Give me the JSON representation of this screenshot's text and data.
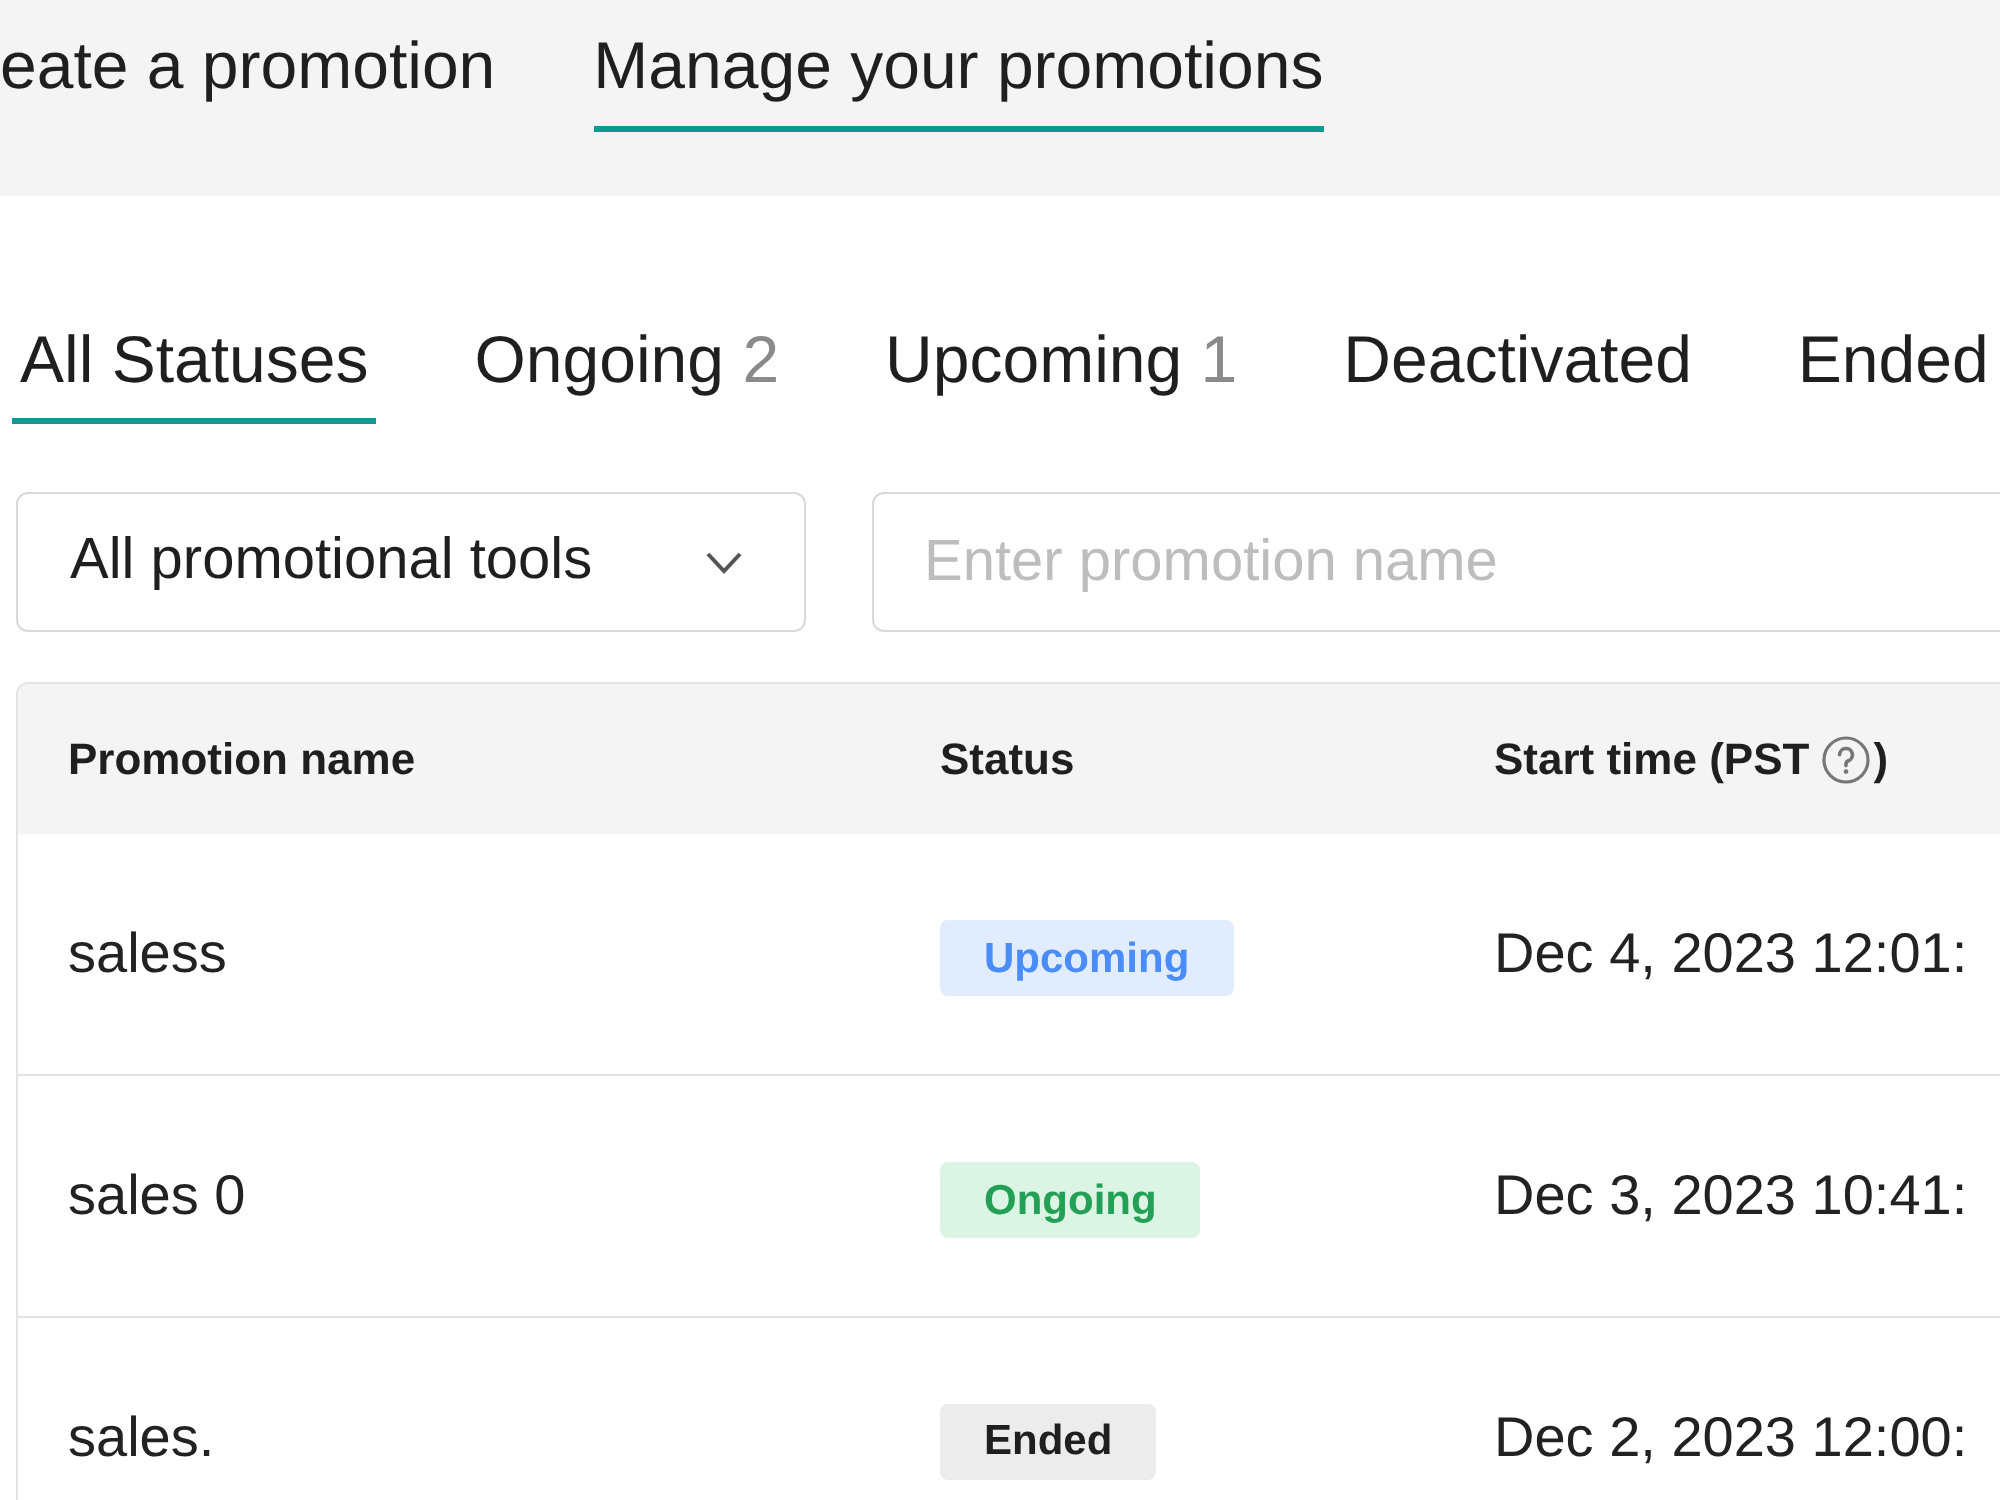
{
  "top_tabs": [
    {
      "label": "eate a promotion",
      "selected": false
    },
    {
      "label": "Manage your promotions",
      "selected": true
    }
  ],
  "status_tabs": [
    {
      "label": "All Statuses",
      "selected": true
    },
    {
      "label": "Ongoing",
      "count": "2",
      "selected": false
    },
    {
      "label": "Upcoming",
      "count": "1",
      "selected": false
    },
    {
      "label": "Deactivated",
      "selected": false
    },
    {
      "label": "Ended",
      "selected": false
    }
  ],
  "filters": {
    "tool_select": {
      "value": "All promotional tools"
    },
    "search": {
      "placeholder": "Enter promotion name"
    }
  },
  "table": {
    "columns": [
      {
        "label": "Promotion name"
      },
      {
        "label": "Status"
      },
      {
        "label": "Start time (PST",
        "help_icon": true,
        "label_end": ")"
      }
    ],
    "rows": [
      {
        "promotion_name": "saless",
        "status": {
          "label": "Upcoming",
          "kind": "upcoming"
        },
        "start_time": "Dec 4, 2023 12:01:"
      },
      {
        "promotion_name": "sales 0",
        "status": {
          "label": "Ongoing",
          "kind": "ongoing"
        },
        "start_time": "Dec 3, 2023 10:41:"
      },
      {
        "promotion_name": "sales.",
        "status": {
          "label": "Ended",
          "kind": "ended"
        },
        "start_time": "Dec 2, 2023 12:00:"
      }
    ]
  }
}
